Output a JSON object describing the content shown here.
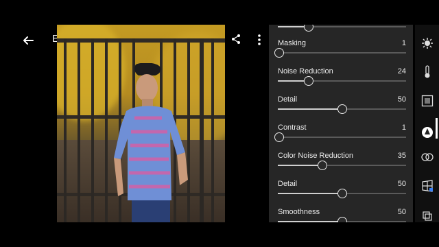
{
  "app": {
    "mode_label": "Edit"
  },
  "detail_panel": {
    "sliders": [
      {
        "label": "",
        "value": ""
      },
      {
        "label": "Masking",
        "value": "1"
      },
      {
        "label": "Noise Reduction",
        "value": "24"
      },
      {
        "label": "Detail",
        "value": "50"
      },
      {
        "label": "Contrast",
        "value": "1"
      },
      {
        "label": "Color Noise Reduction",
        "value": "35"
      },
      {
        "label": "Detail",
        "value": "50"
      },
      {
        "label": "Smoothness",
        "value": "50"
      }
    ],
    "slider_levels": [
      0.24,
      0.01,
      0.24,
      0.5,
      0.01,
      0.35,
      0.5,
      0.5
    ]
  },
  "icons": {
    "top": [
      "back-arrow-icon",
      "undo-icon",
      "check-icon",
      "share-icon",
      "more-vertical-icon"
    ],
    "sidebar": [
      "light-icon",
      "color-temperature-icon",
      "effects-icon",
      "detail-icon",
      "optics-icon",
      "geometry-icon",
      "presets-icon"
    ]
  },
  "colors": {
    "panel_bg": "#262626",
    "sidebar_bg": "#101010",
    "accent_white": "#ffffff"
  }
}
